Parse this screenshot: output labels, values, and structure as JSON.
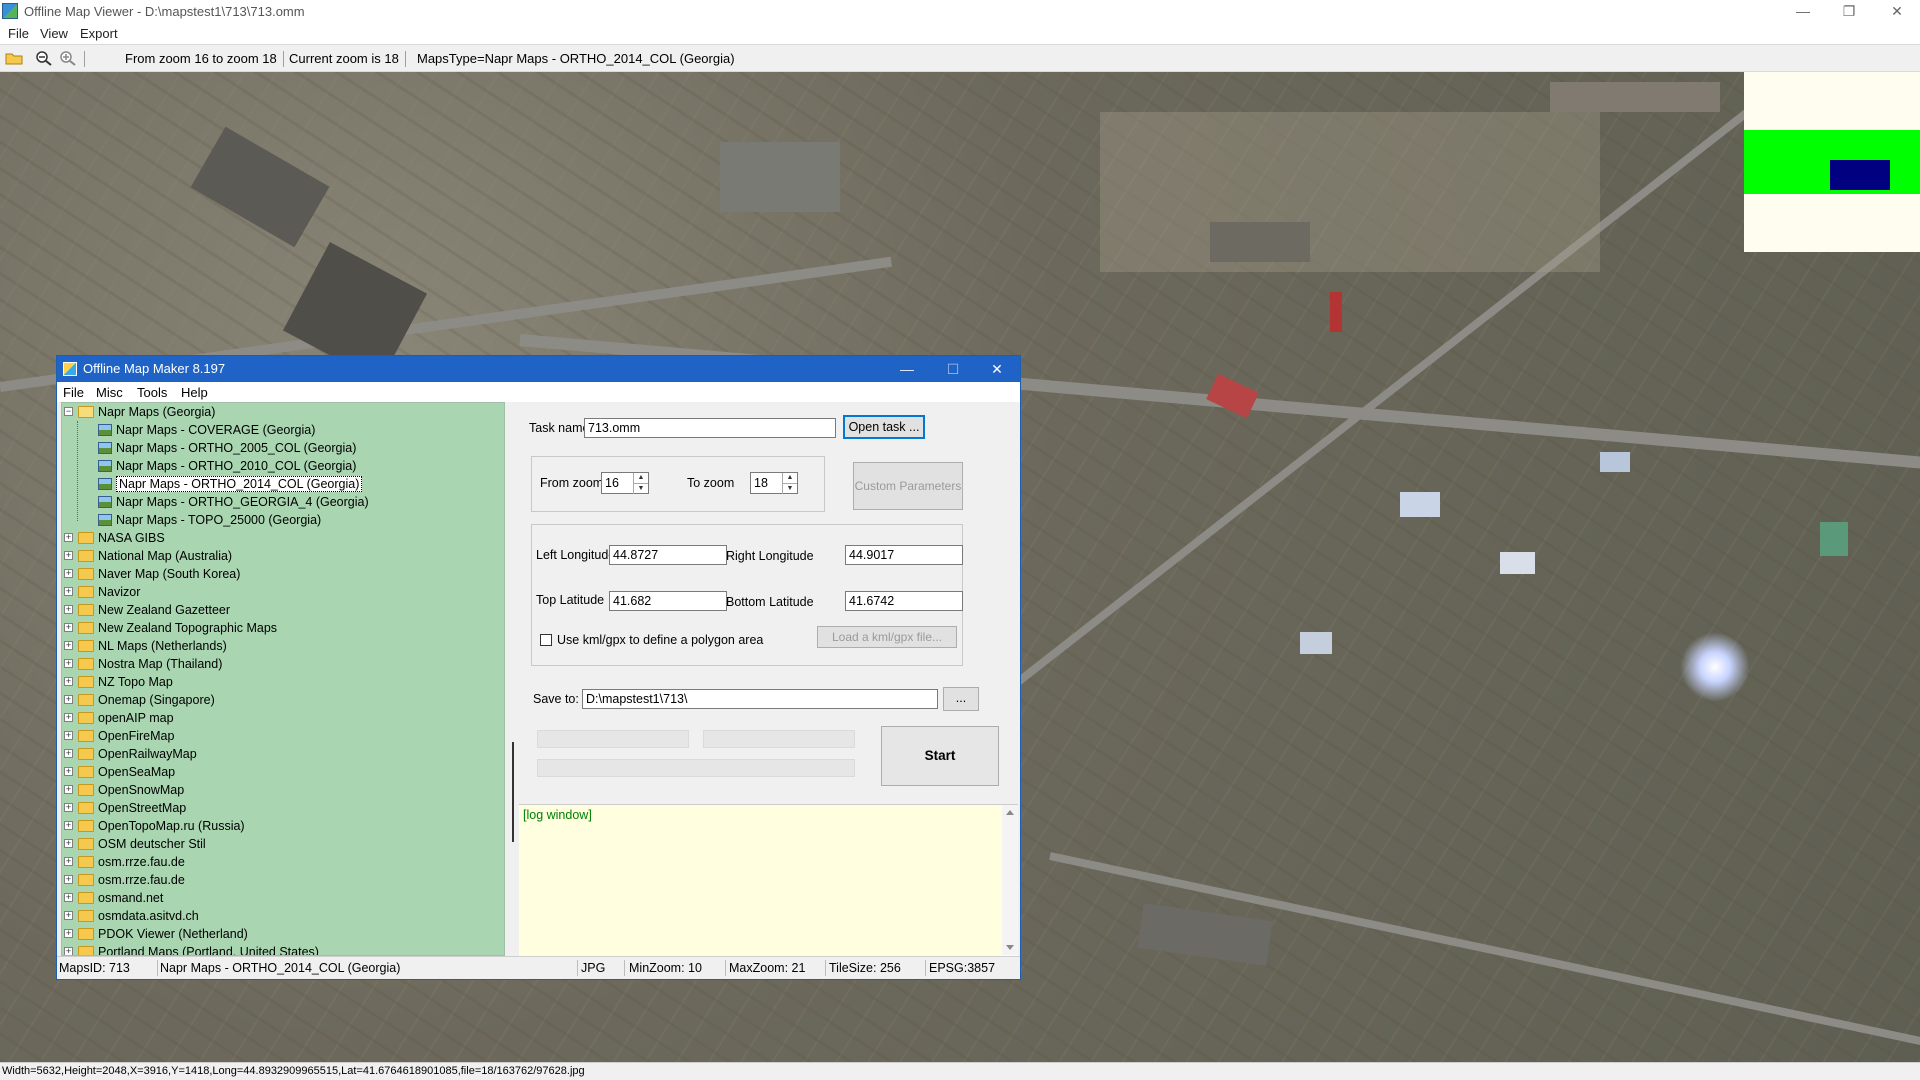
{
  "app": {
    "title": "Offline Map Viewer - D:\\mapstest1\\713\\713.omm",
    "menu": [
      "File",
      "View",
      "Export"
    ],
    "window_controls": {
      "minimize": "—",
      "restore": "❐",
      "close": "✕"
    }
  },
  "toolbar": {
    "icons": [
      "open-folder-icon",
      "zoom-out-icon",
      "zoom-in-icon"
    ],
    "zoom_range": "From zoom 16 to zoom 18",
    "current_zoom": "Current zoom is 18",
    "maps_type": "MapsType=Napr Maps - ORTHO_2014_COL (Georgia)"
  },
  "statusbar": {
    "text": "Width=5632,Height=2048,X=3916,Y=1418,Long=44.8932909965515,Lat=41.6764618901085,file=18/163762/97628.jpg"
  },
  "minimap": {
    "bg": "#fffcf0",
    "band": "#00ff00",
    "viewport": "#000080"
  },
  "dialog": {
    "title": "Offline Map Maker 8.197",
    "menu": [
      "File",
      "Misc",
      "Tools",
      "Help"
    ],
    "controls": {
      "minimize": "—",
      "maximize": "☐",
      "close": "✕"
    },
    "tree": {
      "parent": "Napr Maps (Georgia)",
      "children": [
        "Napr Maps - COVERAGE (Georgia)",
        "Napr Maps - ORTHO_2005_COL (Georgia)",
        "Napr Maps - ORTHO_2010_COL (Georgia)",
        "Napr Maps - ORTHO_2014_COL (Georgia)",
        "Napr Maps - ORTHO_GEORGIA_4 (Georgia)",
        "Napr Maps - TOPO_25000 (Georgia)"
      ],
      "selected_index": 3,
      "folders": [
        "NASA GIBS",
        "National Map (Australia)",
        "Naver Map (South Korea)",
        "Navizor",
        "New Zealand Gazetteer",
        "New Zealand Topographic Maps",
        "NL Maps (Netherlands)",
        "Nostra Map (Thailand)",
        "NZ Topo Map",
        "Onemap (Singapore)",
        "openAIP map",
        "OpenFireMap",
        "OpenRailwayMap",
        "OpenSeaMap",
        "OpenSnowMap",
        "OpenStreetMap",
        "OpenTopoMap.ru (Russia)",
        "OSM deutscher Stil",
        "osm.rrze.fau.de",
        "osm.rrze.fau.de",
        "osmand.net",
        "osmdata.asitvd.ch",
        "PDOK Viewer (Netherland)",
        "Portland Maps (Portland, United States)"
      ]
    },
    "form": {
      "task_name_label": "Task name",
      "task_name_value": "713.omm",
      "open_task_button": "Open task ...",
      "from_zoom_label": "From zoom",
      "from_zoom_value": "16",
      "to_zoom_label": "To zoom",
      "to_zoom_value": "18",
      "custom_params_button": "Custom Parameters",
      "left_lon_label": "Left Longitude",
      "left_lon_value": "44.8727",
      "right_lon_label": "Right Longitude",
      "right_lon_value": "44.9017",
      "top_lat_label": "Top Latitude",
      "top_lat_value": "41.682",
      "bottom_lat_label": "Bottom Latitude",
      "bottom_lat_value": "41.6742",
      "kml_checkbox_label": "Use kml/gpx to define a polygon area",
      "load_kml_button": "Load a kml/gpx file...",
      "save_to_label": "Save to:",
      "save_to_value": "D:\\mapstest1\\713\\",
      "browse_button": "...",
      "start_button": "Start"
    },
    "log": {
      "text": "[log window]"
    },
    "status": {
      "maps_id": "MapsID: 713",
      "map_name": "Napr Maps - ORTHO_2014_COL (Georgia)",
      "format": "JPG",
      "min_zoom": "MinZoom: 10",
      "max_zoom": "MaxZoom: 21",
      "tile_size": "TileSize: 256",
      "epsg": "EPSG:3857"
    }
  }
}
